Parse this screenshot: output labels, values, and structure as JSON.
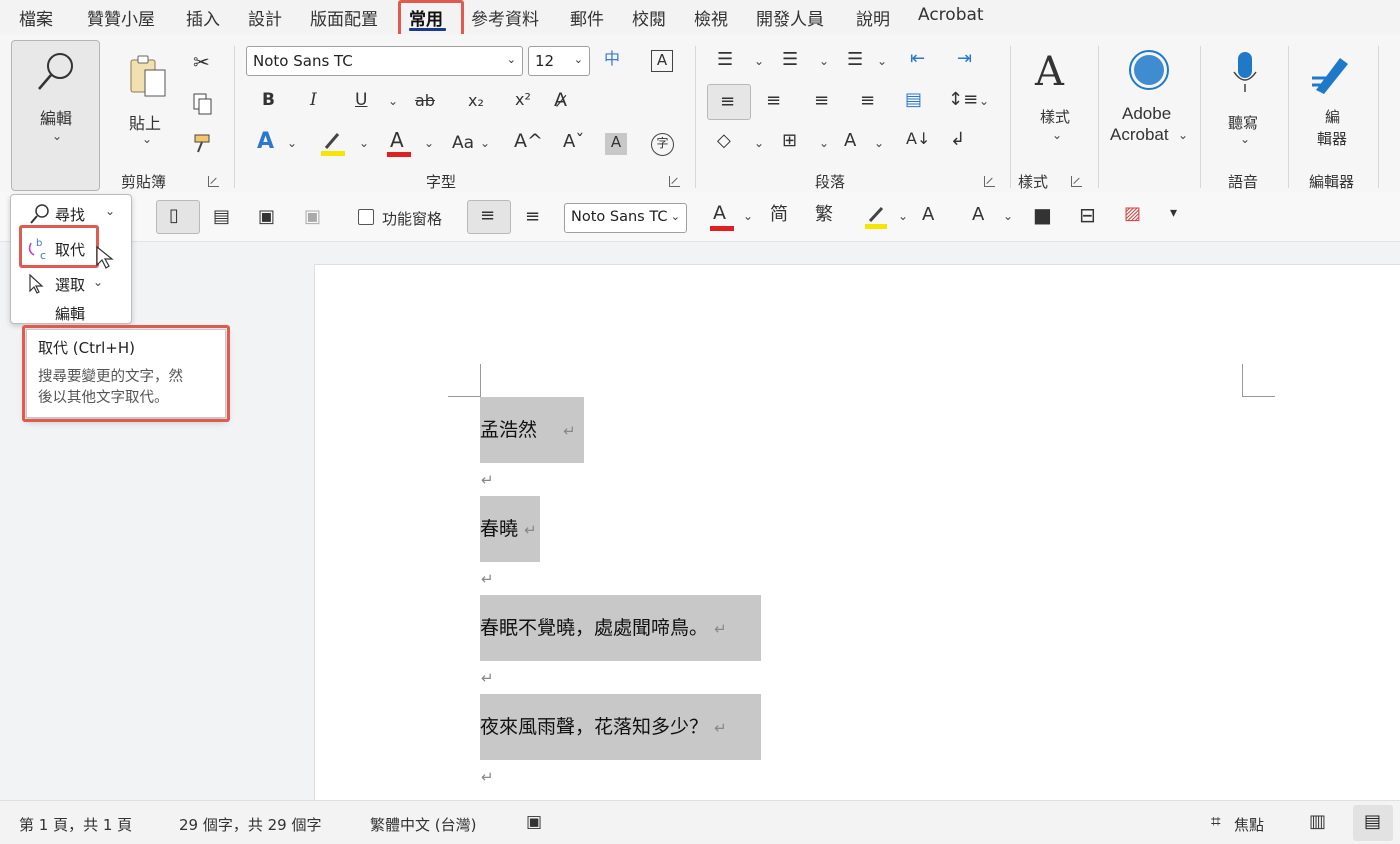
{
  "tabs": [
    "檔案",
    "贊贊小屋",
    "插入",
    "設計",
    "版面配置",
    "常用",
    "參考資料",
    "郵件",
    "校閱",
    "檢視",
    "開發人員",
    "說明",
    "Acrobat"
  ],
  "active_tab": "常用",
  "ribbon": {
    "editing": {
      "label": "編輯"
    },
    "clipboard": {
      "paste_label": "貼上",
      "group_label": "剪貼簿"
    },
    "font": {
      "font_name": "Noto Sans TC",
      "font_size": "12",
      "group_label": "字型",
      "bold": "B",
      "italic": "I",
      "underline": "U",
      "strike": "ab",
      "subscript": "x₂",
      "superscript": "x²",
      "change_case": "Aa",
      "grow_font": "A^",
      "shrink_font": "Aˇ",
      "font_color": "A",
      "char_shading": "A",
      "enclose": "字",
      "phonetic": "中",
      "border_char": "A"
    },
    "paragraph": {
      "group_label": "段落"
    },
    "styles": {
      "label": "樣式",
      "group_label": "樣式"
    },
    "acrobat": {
      "label_line1": "Adobe",
      "label_line2": "Acrobat"
    },
    "voice": {
      "label": "聽寫",
      "group_label": "語音"
    },
    "editor": {
      "label_line1": "編",
      "label_line2": "輯器",
      "group_label": "編輯器"
    }
  },
  "toolbar2": {
    "nav_pane_label": "功能窗格",
    "font_name": "Noto Sans TC",
    "simplified": "简",
    "traditional": "繁"
  },
  "dropdown": {
    "items": [
      {
        "label": "尋找"
      },
      {
        "label": "取代"
      },
      {
        "label": "選取"
      }
    ],
    "group_label": "編輯"
  },
  "tooltip": {
    "title": "取代 (Ctrl+H)",
    "desc_line1": "搜尋要變更的文字，然",
    "desc_line2": "後以其他文字取代。"
  },
  "document": {
    "paragraphs": [
      "孟浩然",
      "春曉",
      "春眠不覺曉，處處聞啼鳥。",
      "夜來風雨聲，花落知多少？"
    ],
    "para_mark": "↵"
  },
  "status": {
    "page": "第 1 頁，共 1 頁",
    "words": "29 個字，共 29 個字",
    "language": "繁體中文 (台灣)",
    "focus": "焦點"
  },
  "colors": {
    "highlight": "#e05a4f",
    "accent": "#1b3a8a",
    "font_red": "#e02020",
    "highlight_yellow": "#f5e600",
    "acrobat_blue": "#1e7ac9"
  }
}
